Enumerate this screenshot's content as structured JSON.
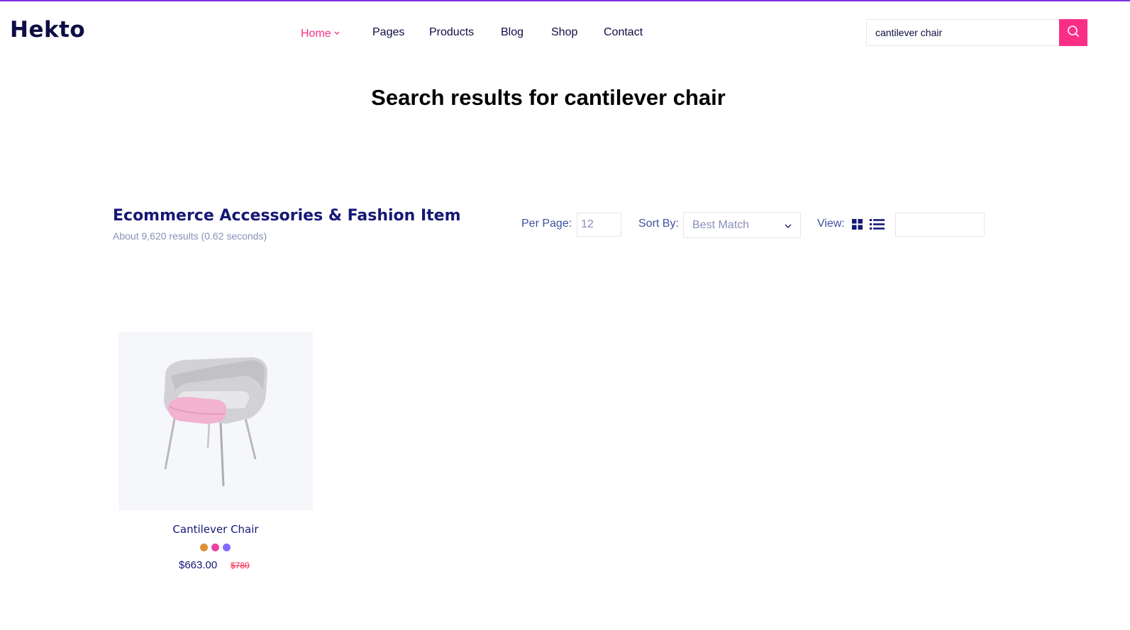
{
  "brand": {
    "logo": "Hekto"
  },
  "nav": [
    {
      "label": "Home"
    },
    {
      "label": "Pages"
    },
    {
      "label": "Products"
    },
    {
      "label": "Blog"
    },
    {
      "label": "Shop"
    },
    {
      "label": "Contact"
    }
  ],
  "search": {
    "value": "cantilever chair",
    "placeholder": ""
  },
  "page": {
    "title": "Search results for cantilever chair"
  },
  "results": {
    "heading": "Ecommerce Accessories & Fashion Item",
    "meta": "About 9,620 results (0.62 seconds)",
    "per_page_label": "Per Page:",
    "per_page_value": "12",
    "sort_label": "Sort By:",
    "sort_value": "Best Match",
    "view_label": "View:"
  },
  "products": [
    {
      "name": "Cantilever Chair",
      "price": "$663.00",
      "old_price": "$780",
      "colors": [
        "#de9034",
        "#ec42a2",
        "#8568ff"
      ]
    }
  ],
  "theme": {
    "accent": "#fb2e86",
    "navy": "#151875",
    "topline": "#7e33e0"
  }
}
